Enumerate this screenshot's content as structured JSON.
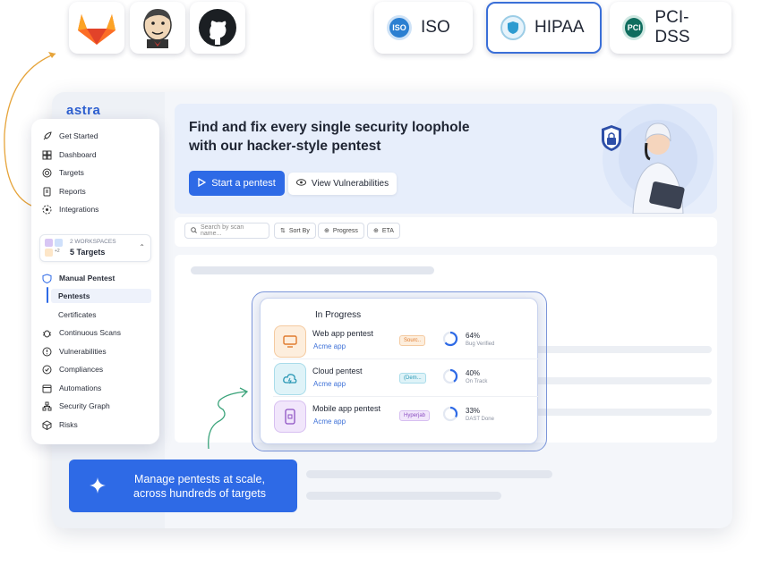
{
  "integrations": [
    {
      "name": "gitlab",
      "icon": "gitlab-icon"
    },
    {
      "name": "jenkins",
      "icon": "jenkins-icon"
    },
    {
      "name": "github",
      "icon": "github-icon"
    }
  ],
  "certifications": [
    {
      "label": "ISO",
      "badge": "ISO",
      "color": "#2b7fd1",
      "active": false
    },
    {
      "label": "HIPAA",
      "badge": "HIPAA",
      "color": "#2d9bd0",
      "active": true
    },
    {
      "label": "PCI-DSS",
      "badge": "PCI",
      "color": "#0f6d5e",
      "active": false
    }
  ],
  "brand": "astra",
  "sidebar": {
    "items": [
      {
        "label": "Get Started",
        "icon": "rocket-icon"
      },
      {
        "label": "Dashboard",
        "icon": "dashboard-icon"
      },
      {
        "label": "Targets",
        "icon": "target-icon"
      },
      {
        "label": "Reports",
        "icon": "report-icon"
      },
      {
        "label": "Integrations",
        "icon": "integrations-icon"
      }
    ],
    "workspace": {
      "count_label": "2 WORKSPACES",
      "targets_label": "5 Targets",
      "extra_badge": "+2"
    },
    "section": {
      "label": "Manual Pentest",
      "sub_items": [
        {
          "label": "Pentests",
          "active": true
        },
        {
          "label": "Certificates",
          "active": false
        }
      ]
    },
    "items2": [
      {
        "label": "Continuous Scans",
        "icon": "bug-icon"
      },
      {
        "label": "Vulnerabilities",
        "icon": "alert-circle-icon"
      },
      {
        "label": "Compliances",
        "icon": "check-circle-icon"
      },
      {
        "label": "Automations",
        "icon": "calendar-icon"
      },
      {
        "label": "Security Graph",
        "icon": "graph-icon"
      },
      {
        "label": "Risks",
        "icon": "cube-icon"
      }
    ]
  },
  "hero": {
    "title": "Find and fix every single security loophole with our hacker-style pentest",
    "primary_button": "Start a pentest",
    "secondary_button": "View Vulnerabilities"
  },
  "toolbar": {
    "search_placeholder": "Search by scan name...",
    "sort_label": "Sort By",
    "progress_label": "Progress",
    "eta_label": "ETA"
  },
  "in_progress": {
    "title": "In Progress",
    "rows": [
      {
        "name": "Web app pentest",
        "app": "Acme app",
        "tag": "Sourc..",
        "tag_color": "#e07b2e",
        "tag_bg": "#fdeedd",
        "pct_label": "64%",
        "pct": 0.64,
        "status": "Bug Verified",
        "icon": "monitor-icon",
        "icon_bg": "#fdeedd",
        "icon_color": "#e07b2e"
      },
      {
        "name": "Cloud pentest",
        "app": "Acme app",
        "tag": "(Dem...",
        "tag_color": "#2a98b5",
        "tag_bg": "#dff3f8",
        "pct_label": "40%",
        "pct": 0.4,
        "status": "On Track",
        "icon": "cloud-icon",
        "icon_bg": "#dff3f8",
        "icon_color": "#2a98b5"
      },
      {
        "name": "Mobile app pentest",
        "app": "Acme app",
        "tag": "Hyperjab",
        "tag_color": "#8c4fc2",
        "tag_bg": "#f1e6fb",
        "pct_label": "33%",
        "pct": 0.33,
        "status": "DAST Done",
        "icon": "mobile-icon",
        "icon_bg": "#f1e6fb",
        "icon_color": "#8c4fc2"
      }
    ]
  },
  "cta": {
    "text_line1": "Manage pentests at scale,",
    "text_line2": "across hundreds of targets"
  },
  "colors": {
    "accent": "#2e6ae6",
    "hero_bg": "#e7eefb"
  }
}
